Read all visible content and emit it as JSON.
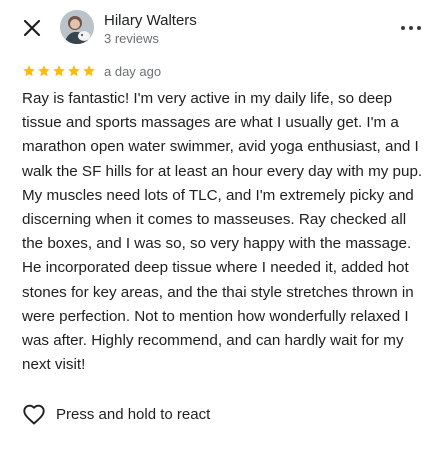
{
  "header": {
    "reviewer_name": "Hilary Walters",
    "reviewer_meta": "3 reviews",
    "close_icon": "close-icon",
    "more_icon": "more-horizontal-icon"
  },
  "rating": {
    "stars": 5,
    "max_stars": 5,
    "star_color": "#fbbc04",
    "time_ago": "a day ago"
  },
  "review": {
    "text": "Ray is fantastic! I'm very active in my daily life, so deep tissue and sports massages are what I usually get. I'm a marathon open water swimmer, avid yoga enthusiast, and I walk the SF hills for at least an hour every day with my pup. My muscles need lots of TLC, and I'm extremely picky and discerning when it comes to masseuses. Ray checked all the boxes, and I was so, so very happy with the massage. He incorporated deep tissue where I needed it, added hot stones for key areas, and the thai style stretches thrown in were perfection. Not to mention how wonderfully relaxed I was after.  Highly recommend, and can hardly wait for my next visit!"
  },
  "react": {
    "label": "Press and hold to react",
    "icon": "heart-outline-icon"
  }
}
